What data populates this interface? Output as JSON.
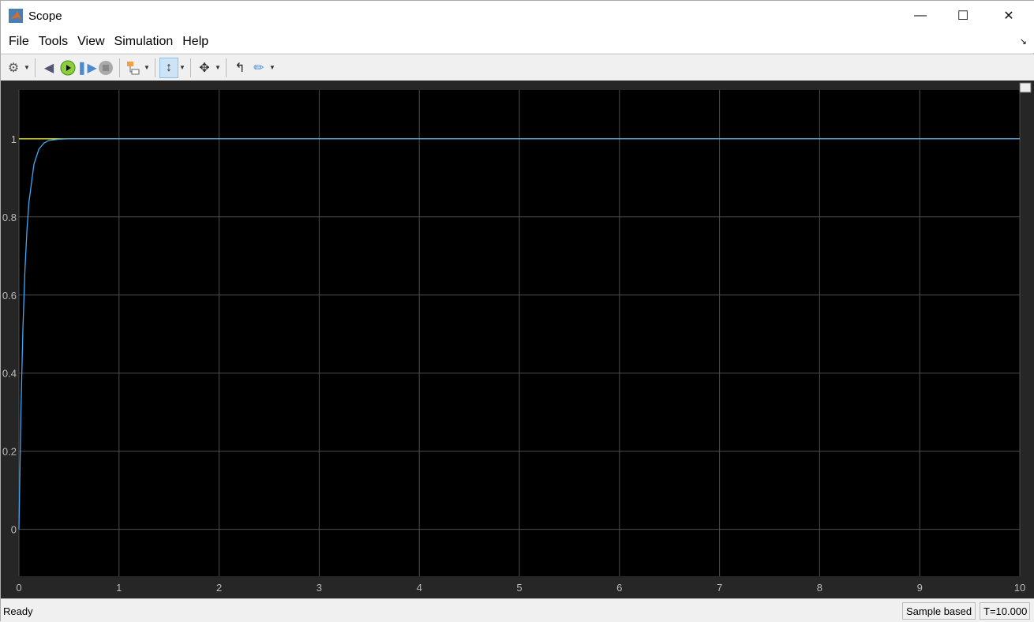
{
  "window": {
    "title": "Scope",
    "minimize_icon": "minimize-icon",
    "maximize_icon": "maximize-icon",
    "close_icon": "close-icon"
  },
  "menu": [
    "File",
    "Tools",
    "View",
    "Simulation",
    "Help"
  ],
  "toolbar": [
    "settings-icon",
    "step-back-icon",
    "run-icon",
    "step-forward-icon",
    "stop-icon",
    "highlight-block-icon",
    "zoom-y-icon",
    "fit-to-view-icon",
    "triggers-icon",
    "measurements-icon"
  ],
  "status": {
    "left": "Ready",
    "mode": "Sample based",
    "time": "T=10.000"
  },
  "colors": {
    "background": "#000000",
    "grid": "#4d4d4d",
    "response": "#3fa9f5",
    "reference": "#ffff00"
  },
  "chart_data": {
    "type": "line",
    "xlim": [
      0,
      10
    ],
    "ylim": [
      -0.12,
      1.125
    ],
    "grid": true,
    "xticks": [
      0,
      1,
      2,
      3,
      4,
      5,
      6,
      7,
      8,
      9,
      10
    ],
    "yticks": [
      0,
      0.2,
      0.4,
      0.6,
      0.8,
      1
    ],
    "series": [
      {
        "color": "#ffff00",
        "x": [
          0,
          10
        ],
        "y": [
          1,
          1
        ]
      },
      {
        "color": "#3fa9f5",
        "x": [
          0,
          0.02,
          0.04,
          0.06,
          0.08,
          0.1,
          0.15,
          0.2,
          0.25,
          0.3,
          0.4,
          0.5,
          10
        ],
        "y": [
          0,
          0.305,
          0.517,
          0.664,
          0.766,
          0.838,
          0.935,
          0.974,
          0.989,
          0.996,
          0.999,
          1,
          1
        ]
      }
    ]
  }
}
